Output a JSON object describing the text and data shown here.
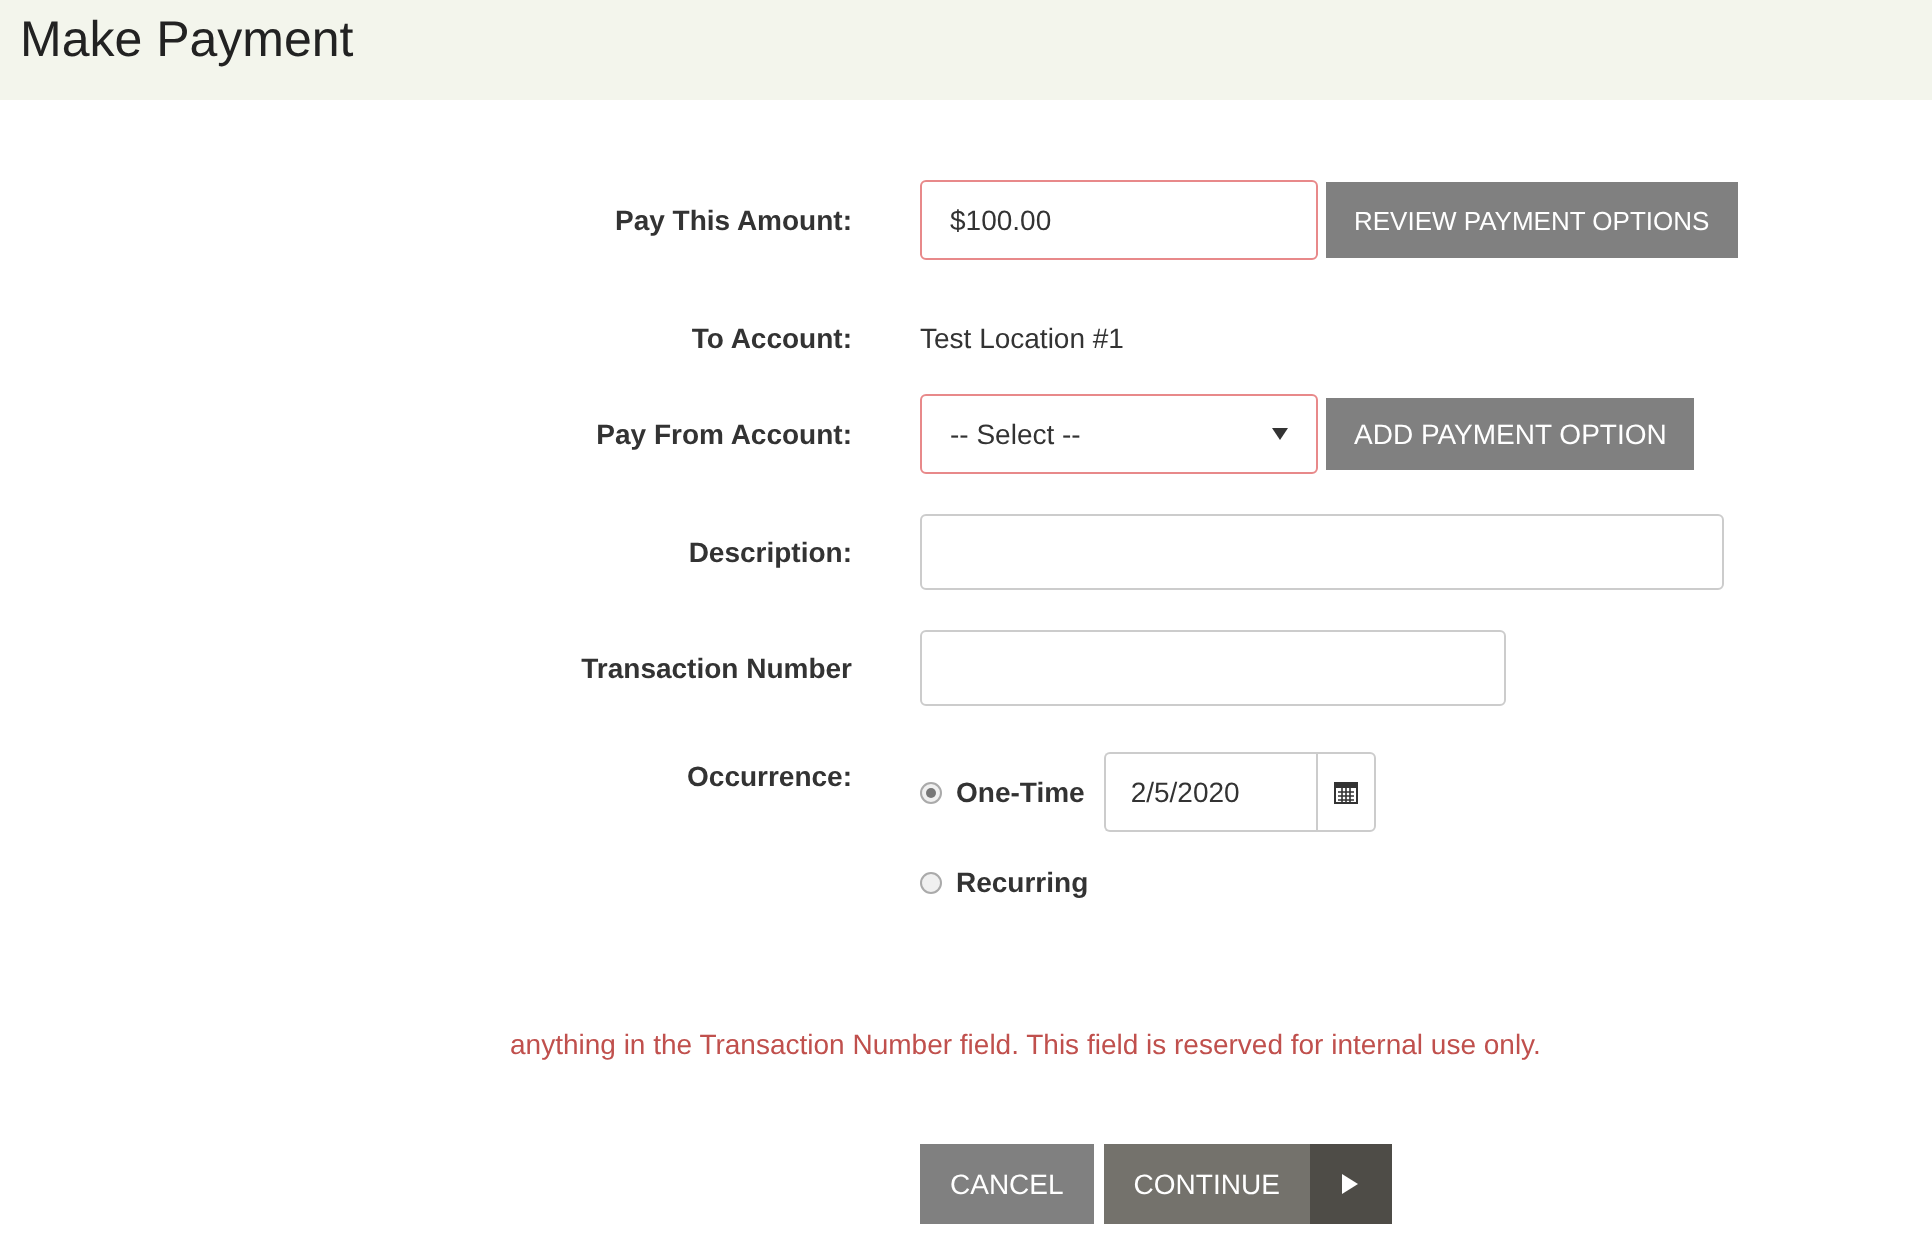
{
  "header": {
    "title": "Make Payment"
  },
  "form": {
    "rows": [
      {
        "kind": "amount",
        "label": "Pay This Amount:",
        "value": "$100.00",
        "invalid": true,
        "button": "REVIEW PAYMENT OPTIONS"
      },
      {
        "kind": "static",
        "label": "To Account:",
        "value": "Test Location #1"
      },
      {
        "kind": "select",
        "label": "Pay From Account:",
        "value": "-- Select --",
        "invalid": true,
        "button": "ADD PAYMENT OPTION"
      },
      {
        "kind": "text",
        "label": "Description:",
        "value": "",
        "invalid": false
      },
      {
        "kind": "text",
        "label": "Transaction Number",
        "value": "",
        "invalid": false
      },
      {
        "kind": "occurrence",
        "label": "Occurrence:",
        "options": [
          {
            "label": "One-Time",
            "selected": true,
            "date": "2/5/2020"
          },
          {
            "label": "Recurring",
            "selected": false
          }
        ]
      }
    ]
  },
  "message": "anything in the Transaction Number field. This field is reserved for internal use only.",
  "buttons": [
    {
      "kind": "cancel",
      "label": "CANCEL"
    },
    {
      "kind": "continue",
      "label": "CONTINUE"
    }
  ]
}
